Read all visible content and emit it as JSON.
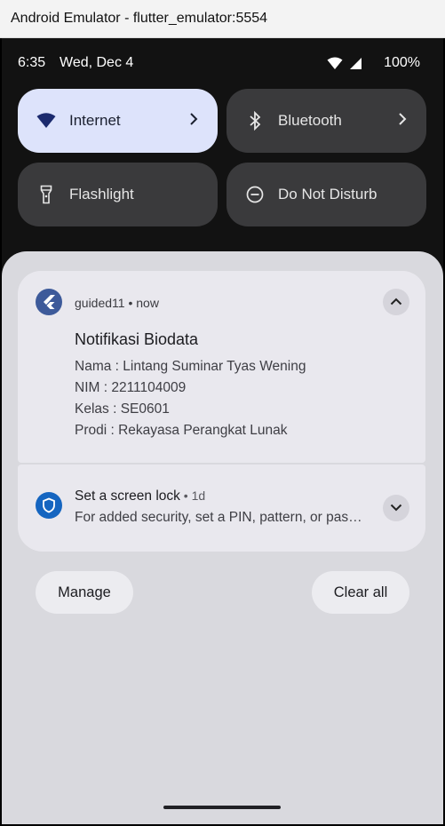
{
  "window": {
    "title": "Android Emulator - flutter_emulator:5554"
  },
  "status_bar": {
    "time": "6:35",
    "date": "Wed, Dec 4",
    "battery": "100%"
  },
  "quick_tiles": [
    {
      "label": "Internet",
      "icon": "wifi-icon",
      "active": true,
      "has_chevron": true
    },
    {
      "label": "Bluetooth",
      "icon": "bluetooth-icon",
      "active": false,
      "has_chevron": true
    },
    {
      "label": "Flashlight",
      "icon": "flashlight-icon",
      "active": false,
      "has_chevron": false
    },
    {
      "label": "Do Not Disturb",
      "icon": "do-not-disturb-icon",
      "active": false,
      "has_chevron": false
    }
  ],
  "notifications": {
    "biodata": {
      "app_name": "guided11",
      "time": "now",
      "app_meta": "guided11 • now",
      "title": "Notifikasi Biodata",
      "lines": [
        "Nama : Lintang Suminar Tyas Wening",
        "NIM : 2211104009",
        "Kelas : SE0601",
        "Prodi : Rekayasa Perangkat Lunak"
      ]
    },
    "screen_lock": {
      "title": "Set a screen lock",
      "meta": " • 1d",
      "body": "For added security, set a PIN, pattern, or password"
    }
  },
  "actions": {
    "manage": "Manage",
    "clear_all": "Clear all"
  },
  "colors": {
    "tile_active_bg": "#dde3fb",
    "tile_inactive_bg": "#3a3a3c",
    "shade_bg": "#d9d9de",
    "card_bg": "#e9e8ee",
    "app_icon_bg": "#3d5a9a",
    "shield_icon_bg": "#1565c0"
  }
}
